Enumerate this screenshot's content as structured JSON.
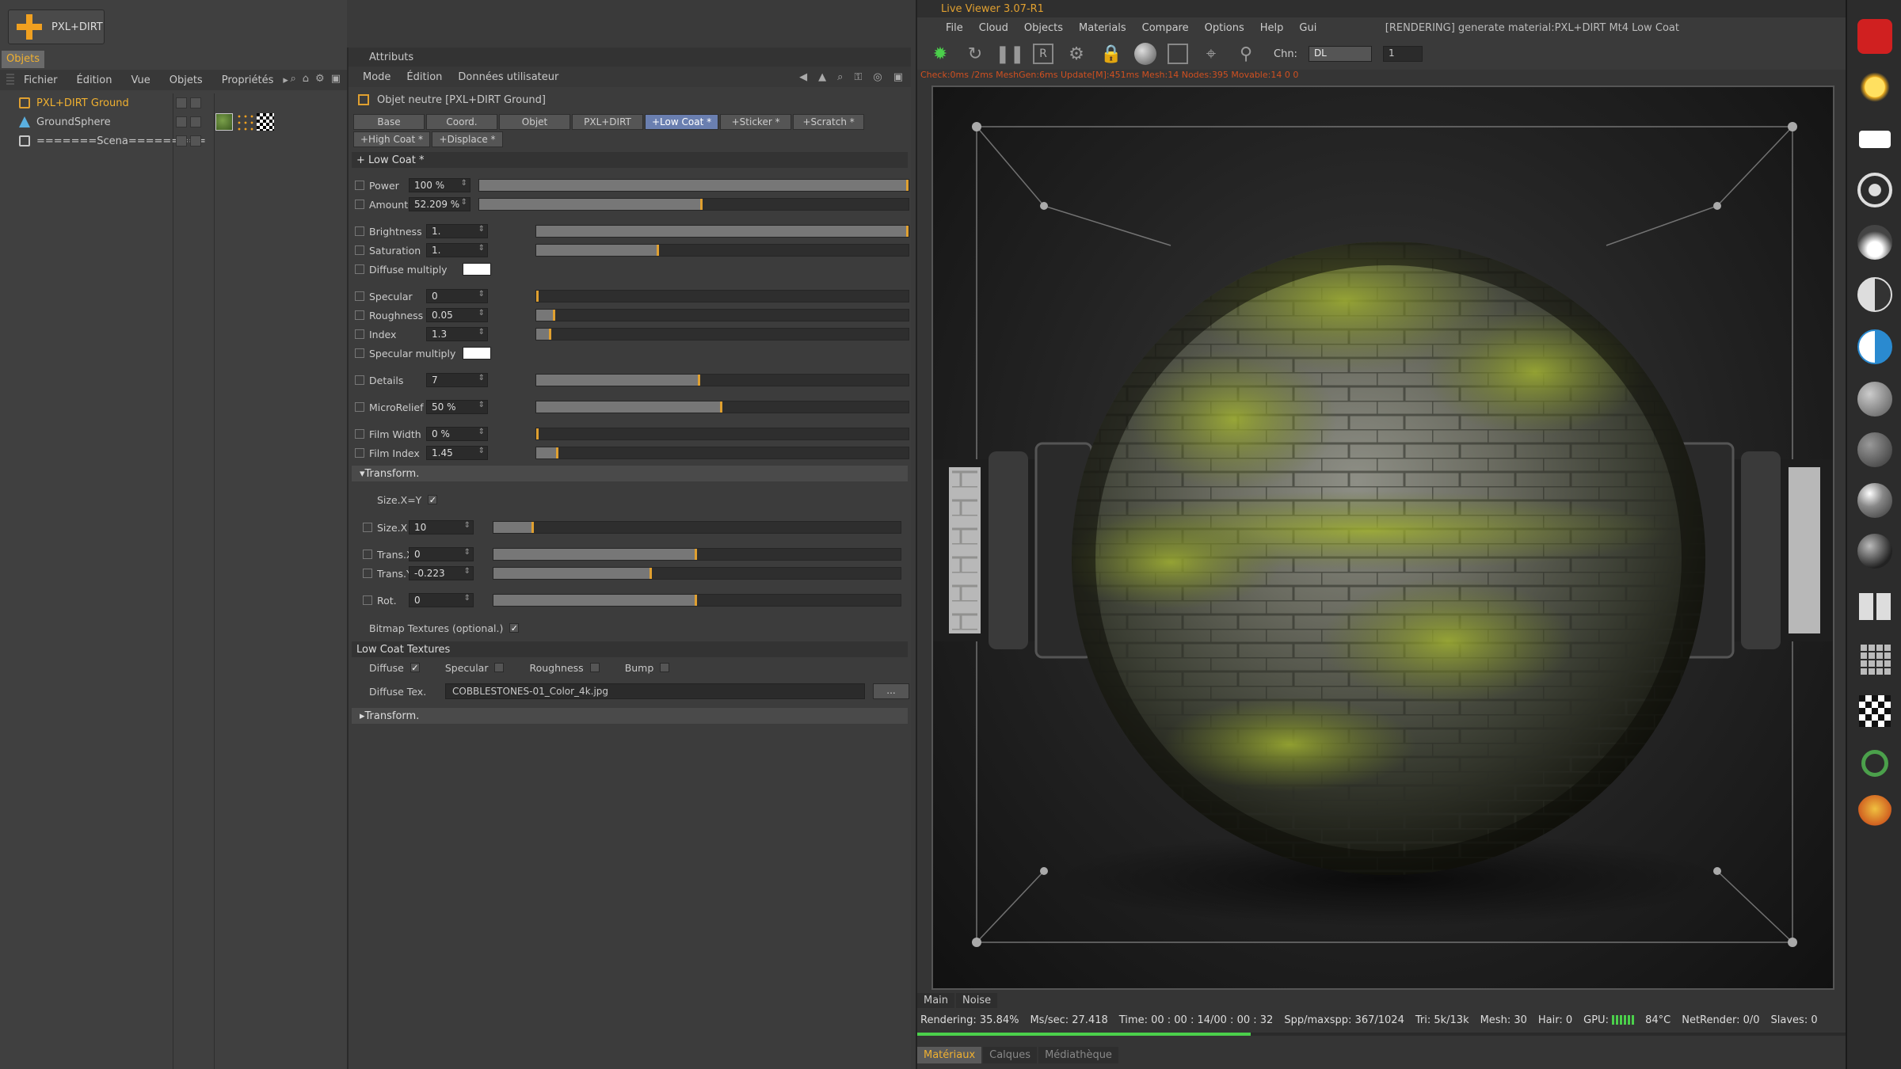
{
  "left": {
    "app_button": "PXL+DIRT",
    "tab": "Objets",
    "menu": [
      "Fichier",
      "Édition",
      "Vue",
      "Objets",
      "Propriétés"
    ],
    "tree": [
      {
        "label": "PXL+DIRT Ground",
        "icon": "null-object-icon",
        "color": "#f0b030"
      },
      {
        "label": "GroundSphere",
        "icon": "sphere-icon",
        "color": "#c8c8c8"
      },
      {
        "label": "=======Scena=========",
        "icon": "scene-icon",
        "color": "#c8c8c8"
      }
    ]
  },
  "attrs": {
    "title": "Attributs",
    "menu": [
      "Mode",
      "Édition",
      "Données utilisateur"
    ],
    "object_line": "Objet neutre [PXL+DIRT Ground]",
    "tabs": [
      "Base",
      "Coord.",
      "Objet",
      "PXL+DIRT",
      "+Low Coat *",
      "+Sticker *",
      "+Scratch *",
      "+High Coat *",
      "+Displace *"
    ],
    "active_tab": 4,
    "section": "+ Low Coat *",
    "params_a": [
      {
        "label": "Power",
        "value": "100 %",
        "level": 1.0
      },
      {
        "label": "Amount",
        "value": "52.209 %",
        "level": 0.52
      }
    ],
    "params_b": [
      {
        "label": "Brightness",
        "value": "1.",
        "level": 1.0
      },
      {
        "label": "Saturation",
        "value": "1.",
        "level": 0.33
      }
    ],
    "diffuse_multiply": "Diffuse multiply",
    "params_c": [
      {
        "label": "Specular",
        "value": "0",
        "level": 0.0
      },
      {
        "label": "Roughness",
        "value": "0.05",
        "level": 0.05
      },
      {
        "label": "Index",
        "value": "1.3",
        "level": 0.04
      }
    ],
    "specular_multiply": "Specular multiply",
    "details": {
      "label": "Details",
      "value": "7",
      "level": 0.44
    },
    "microrelief": {
      "label": "MicroRelief",
      "value": "50 %",
      "level": 0.5
    },
    "params_d": [
      {
        "label": "Film Width",
        "value": "0 %",
        "level": 0.0
      },
      {
        "label": "Film Index",
        "value": "1.45",
        "level": 0.06
      }
    ],
    "transform_head": "Transform.",
    "size_xy": "Size.X=Y",
    "transform": [
      {
        "label": "Size.X",
        "value": "10",
        "level": 0.1
      },
      {
        "label": "Trans.X",
        "value": "0",
        "level": 0.5
      },
      {
        "label": "Trans.Y",
        "value": "-0.223",
        "level": 0.39
      },
      {
        "label": "Rot.",
        "value": "0",
        "level": 0.5
      }
    ],
    "bitmap_textures": "Bitmap Textures (optional.)",
    "low_coat_textures": "Low Coat Textures",
    "tex_checks": [
      {
        "label": "Diffuse",
        "checked": true
      },
      {
        "label": "Specular",
        "checked": false
      },
      {
        "label": "Roughness",
        "checked": false
      },
      {
        "label": "Bump",
        "checked": false
      }
    ],
    "diffuse_tex_label": "Diffuse Tex.",
    "diffuse_tex_value": "COBBLESTONES-01_Color_4k.jpg",
    "browse": "...",
    "transform2": "Transform."
  },
  "viewer": {
    "title": "Live Viewer 3.07-R1",
    "menu": [
      "File",
      "Cloud",
      "Objects",
      "Materials",
      "Compare",
      "Options",
      "Help",
      "Gui"
    ],
    "status": "[RENDERING] generate material:PXL+DIRT Mt4 Low Coat",
    "chn_label": "Chn:",
    "chn_value": "DL",
    "frame": "1",
    "stats": "Check:0ms /2ms  MeshGen:6ms  Update[M]:451ms  Mesh:14 Nodes:395 Movable:14  0 0",
    "tabs": [
      "Main",
      "Noise"
    ],
    "statusbar": {
      "rendering": "Rendering: 35.84%",
      "ms": "Ms/sec: 27.418",
      "time": "Time: 00 : 00 : 14/00 : 00 : 32",
      "spp": "Spp/maxspp: 367/1024",
      "tri": "Tri: 5k/13k",
      "mesh": "Mesh: 30",
      "hair": "Hair: 0",
      "gpu": "GPU:",
      "temp": "84°C",
      "netrender": "NetRender: 0/0",
      "slaves": "Slaves: 0"
    },
    "progress": 0.3584,
    "bottom_tabs": [
      "Matériaux",
      "Calques",
      "Médiathèque"
    ],
    "right_icons": [
      "camera-icon",
      "sun-light-icon",
      "area-light-icon",
      "target-light-icon",
      "ies-light-icon",
      "half-disc-icon",
      "blue-half-disc-icon",
      "gray-sphere-icon",
      "dim-sphere-icon",
      "glossy-sphere-icon",
      "dark-sphere-icon",
      "puzzle-icon",
      "grid-icon",
      "checker-icon",
      "recycle-icon",
      "tree-icon"
    ]
  },
  "colors": {
    "accent": "#f0b030",
    "active_tab": "#6a7fb0",
    "progress": "#4bd04b"
  }
}
